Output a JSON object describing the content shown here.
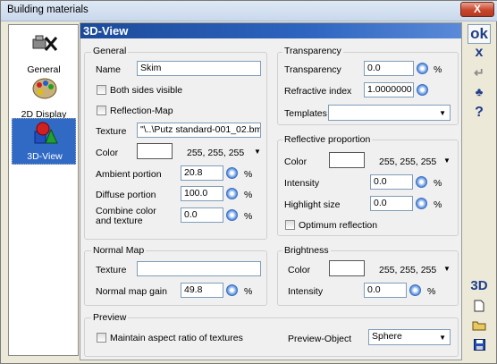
{
  "window": {
    "title": "Building materials",
    "close_label": "X"
  },
  "sidebar": {
    "items": [
      {
        "label": "General",
        "icon": "tools-icon"
      },
      {
        "label": "2D Display",
        "icon": "palette-icon"
      },
      {
        "label": "3D-View",
        "icon": "shapes-icon",
        "selected": true
      }
    ]
  },
  "panel": {
    "title": "3D-View"
  },
  "general": {
    "group_title": "General",
    "name_label": "Name",
    "name_value": "Skim",
    "both_sides_label": "Both sides visible",
    "reflection_map_label": "Reflection-Map",
    "texture_label": "Texture",
    "texture_value": "\"\\..\\Putz standard-001_02.bmp",
    "color_label": "Color",
    "color_value": "255, 255, 255",
    "ambient_label": "Ambient portion",
    "ambient_value": "20.8",
    "diffuse_label": "Diffuse portion",
    "diffuse_value": "100.0",
    "combine_label_1": "Combine color",
    "combine_label_2": "and texture",
    "combine_value": "0.0",
    "percent": "%"
  },
  "transparency": {
    "group_title": "Transparency",
    "transparency_label": "Transparency",
    "transparency_value": "0.0",
    "refractive_label": "Refractive index",
    "refractive_value": "1.0000000",
    "templates_label": "Templates",
    "templates_value": ""
  },
  "reflective": {
    "group_title": "Reflective proportion",
    "color_label": "Color",
    "color_value": "255, 255, 255",
    "intensity_label": "Intensity",
    "intensity_value": "0.0",
    "highlight_label": "Highlight size",
    "highlight_value": "0.0",
    "optimum_label": "Optimum reflection"
  },
  "normal_map": {
    "group_title": "Normal Map",
    "texture_label": "Texture",
    "texture_value": "",
    "gain_label": "Normal map gain",
    "gain_value": "49.8"
  },
  "brightness": {
    "group_title": "Brightness",
    "color_label": "Color",
    "color_value": "255, 255, 255",
    "intensity_label": "Intensity",
    "intensity_value": "0.0"
  },
  "preview": {
    "group_title": "Preview",
    "maintain_label": "Maintain aspect ratio of textures",
    "object_label": "Preview-Object",
    "object_value": "Sphere"
  },
  "toolbar": {
    "ok_label": "ok",
    "cancel_label": "x",
    "three_d_label": "3D",
    "help_label": "?"
  },
  "colors": {
    "accent": "#1b4a9a",
    "selection": "#316ac5"
  }
}
